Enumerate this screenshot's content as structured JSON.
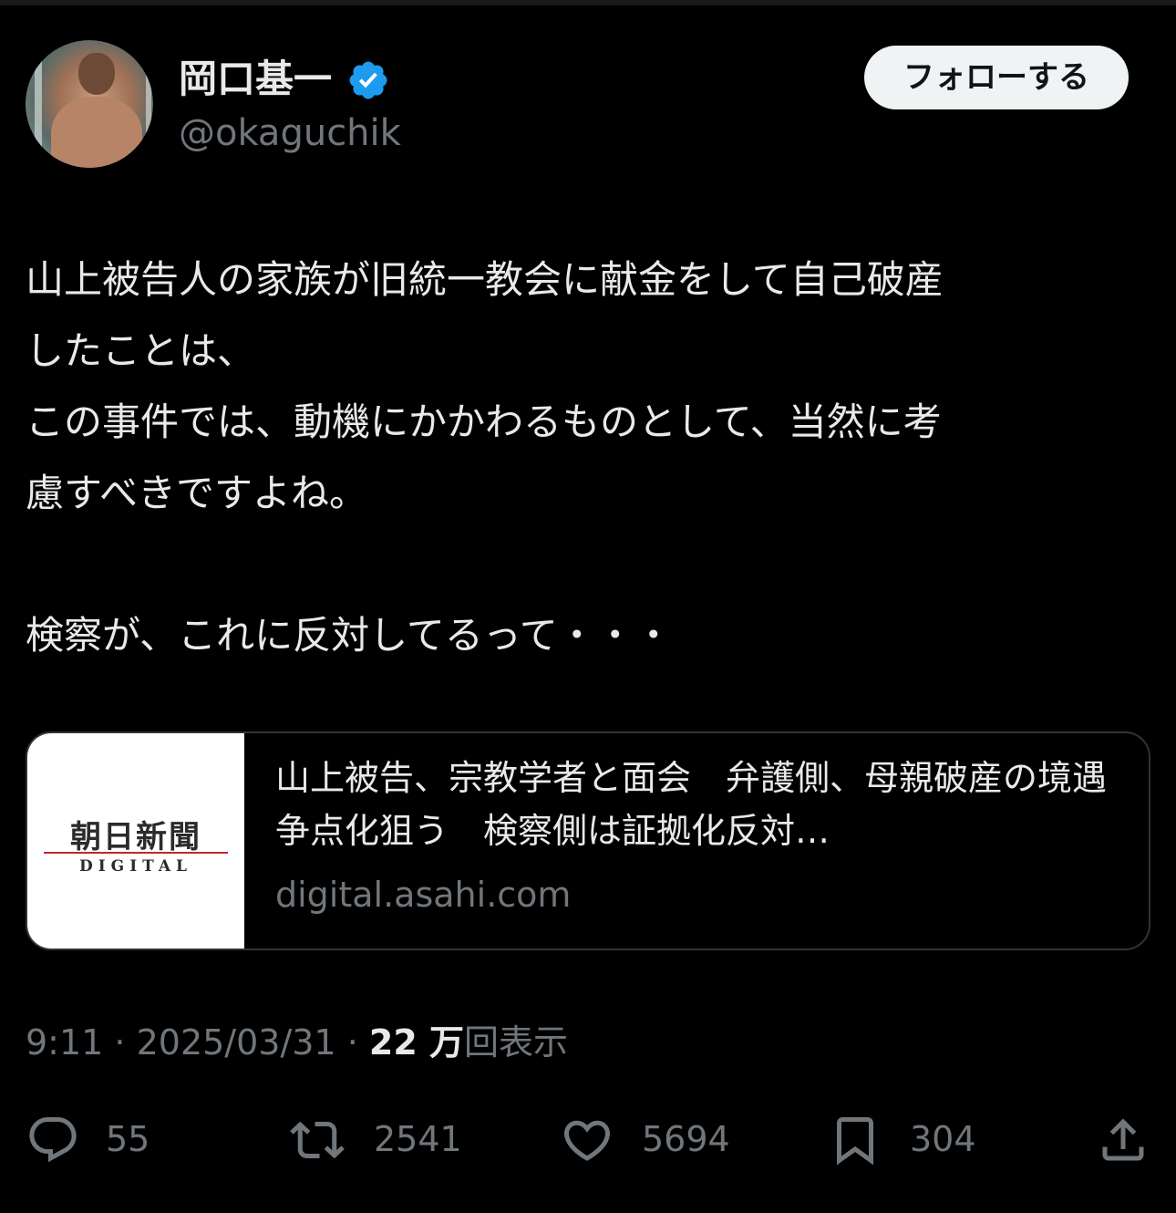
{
  "author": {
    "display_name": "岡口基一",
    "handle": "@okaguchik",
    "verified_icon": "verified-badge-icon",
    "verified_color": "#1d9bf0"
  },
  "follow_button": {
    "label": "フォローする"
  },
  "tweet": {
    "text": "山上被告人の家族が旧統一教会に献金をして自己破産\nしたことは、\nこの事件では、動機にかかわるものとして、当然に考\n慮すべきですよね。\n\n検察が、これに反対してるって・・・"
  },
  "link_card": {
    "logo_text": "朝日新聞",
    "logo_subtext": "DIGITAL",
    "title": "山上被告、宗教学者と面会　弁護側、母親破産の境遇争点化狙う　検察側は証拠化反対…",
    "domain": "digital.asahi.com"
  },
  "meta": {
    "time": "9:11",
    "separator": " · ",
    "date": "2025/03/31",
    "views_number": "22 万",
    "views_label": "回表示"
  },
  "actions": {
    "replies": {
      "icon": "reply-icon",
      "count": "55"
    },
    "retweets": {
      "icon": "retweet-icon",
      "count": "2541"
    },
    "likes": {
      "icon": "heart-icon",
      "count": "5694"
    },
    "bookmarks": {
      "icon": "bookmark-icon",
      "count": "304"
    },
    "share": {
      "icon": "share-icon"
    }
  }
}
